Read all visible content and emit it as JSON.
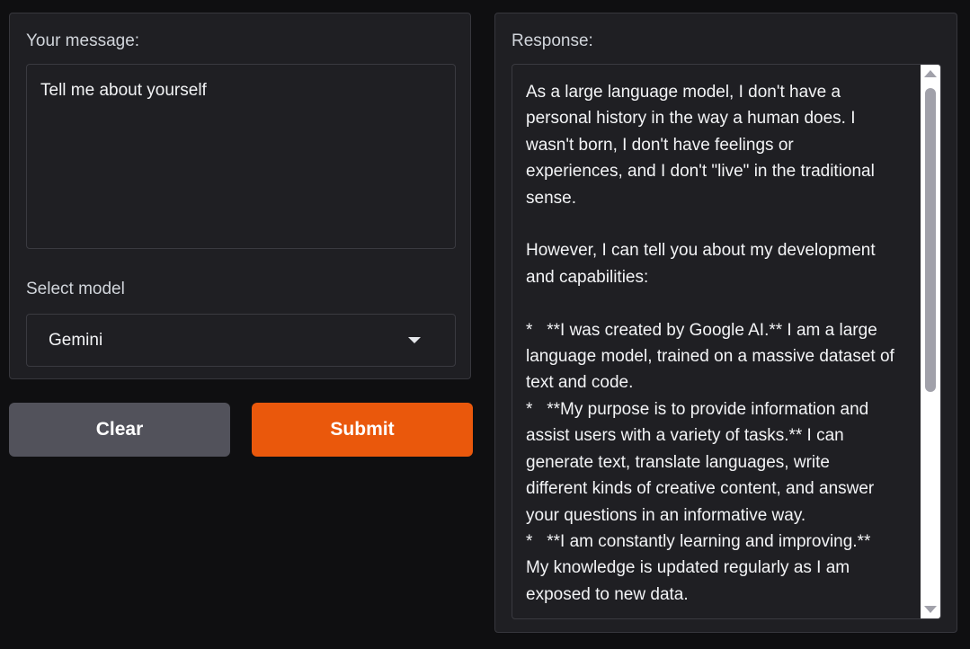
{
  "input_panel": {
    "message_label": "Your message:",
    "message_value": "Tell me about yourself",
    "model_label": "Select model",
    "model_selected": "Gemini"
  },
  "buttons": {
    "clear_label": "Clear",
    "submit_label": "Submit"
  },
  "response_panel": {
    "label": "Response:",
    "text": "As a large language model, I don't have a\npersonal history in the way a human does. I\nwasn't born, I don't have feelings or\nexperiences, and I don't \"live\" in the traditional\nsense.\n\nHowever, I can tell you about my development\nand capabilities:\n\n*   **I was created by Google AI.** I am a large\nlanguage model, trained on a massive dataset of\ntext and code.\n*   **My purpose is to provide information and\nassist users with a variety of tasks.** I can\ngenerate text, translate languages, write\ndifferent kinds of creative content, and answer\nyour questions in an informative way.\n*   **I am constantly learning and improving.**\nMy knowledge is updated regularly as I am\nexposed to new data."
  },
  "colors": {
    "background": "#0f0f11",
    "panel": "#1f1f23",
    "submit": "#ea580c",
    "clear": "#52525b"
  }
}
